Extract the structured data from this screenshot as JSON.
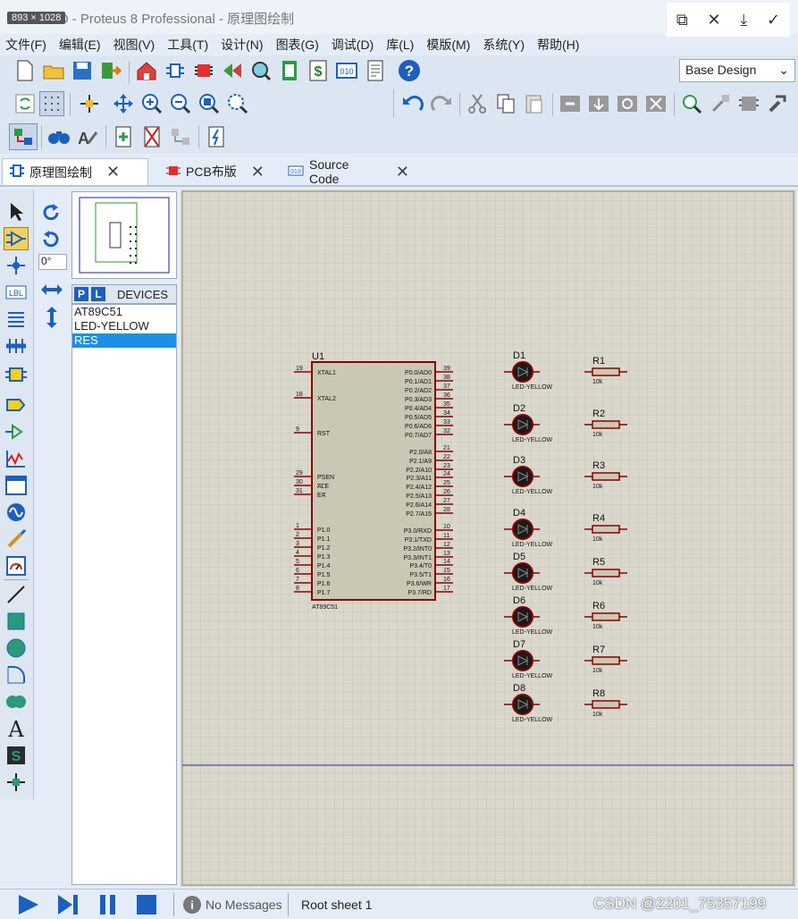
{
  "window": {
    "title": "1.51 LED - Proteus 8 Professional - 原理图绘制",
    "size_badge": "893 × 1028"
  },
  "menu": [
    "文件(F)",
    "编辑(E)",
    "视图(V)",
    "工具(T)",
    "设计(N)",
    "图表(G)",
    "调试(D)",
    "库(L)",
    "模版(M)",
    "系统(Y)",
    "帮助(H)"
  ],
  "design_select": "Base Design",
  "tabs": [
    {
      "label": "原理图绘制"
    },
    {
      "label": "PCB布版"
    },
    {
      "label": "Source Code"
    }
  ],
  "rotation": "0°",
  "devices": {
    "header": "DEVICES",
    "p": "P",
    "l": "L",
    "items": [
      "AT89C51",
      "LED-YELLOW",
      "RES"
    ],
    "selected": "RES"
  },
  "chip": {
    "ref": "U1",
    "name": "AT89C51",
    "left_pins": [
      {
        "n": "19",
        "l": "XTAL1"
      },
      {
        "n": "18",
        "l": "XTAL2"
      },
      {
        "n": "9",
        "l": "RST"
      },
      {
        "n": "29",
        "l": "PSEN"
      },
      {
        "n": "30",
        "l": "ALE"
      },
      {
        "n": "31",
        "l": "EA"
      },
      {
        "n": "1",
        "l": "P1.0"
      },
      {
        "n": "2",
        "l": "P1.1"
      },
      {
        "n": "3",
        "l": "P1.2"
      },
      {
        "n": "4",
        "l": "P1.3"
      },
      {
        "n": "5",
        "l": "P1.4"
      },
      {
        "n": "6",
        "l": "P1.5"
      },
      {
        "n": "7",
        "l": "P1.6"
      },
      {
        "n": "8",
        "l": "P1.7"
      }
    ],
    "right_pins": [
      {
        "n": "39",
        "l": "P0.0/AD0"
      },
      {
        "n": "38",
        "l": "P0.1/AD1"
      },
      {
        "n": "37",
        "l": "P0.2/AD2"
      },
      {
        "n": "36",
        "l": "P0.3/AD3"
      },
      {
        "n": "35",
        "l": "P0.4/AD4"
      },
      {
        "n": "34",
        "l": "P0.5/AD5"
      },
      {
        "n": "33",
        "l": "P0.6/AD6"
      },
      {
        "n": "32",
        "l": "P0.7/AD7"
      },
      {
        "n": "21",
        "l": "P2.0/A8"
      },
      {
        "n": "22",
        "l": "P2.1/A9"
      },
      {
        "n": "23",
        "l": "P2.2/A10"
      },
      {
        "n": "24",
        "l": "P2.3/A11"
      },
      {
        "n": "25",
        "l": "P2.4/A12"
      },
      {
        "n": "26",
        "l": "P2.5/A13"
      },
      {
        "n": "27",
        "l": "P2.6/A14"
      },
      {
        "n": "28",
        "l": "P2.7/A15"
      },
      {
        "n": "10",
        "l": "P3.0/RXD"
      },
      {
        "n": "11",
        "l": "P3.1/TXD"
      },
      {
        "n": "12",
        "l": "P3.2/INT0"
      },
      {
        "n": "13",
        "l": "P3.3/INT1"
      },
      {
        "n": "14",
        "l": "P3.4/T0"
      },
      {
        "n": "15",
        "l": "P3.5/T1"
      },
      {
        "n": "16",
        "l": "P3.6/WR"
      },
      {
        "n": "17",
        "l": "P3.7/RD"
      }
    ]
  },
  "leds": [
    {
      "ref": "D1",
      "type": "LED-YELLOW"
    },
    {
      "ref": "D2",
      "type": "LED-YELLOW"
    },
    {
      "ref": "D3",
      "type": "LED-YELLOW"
    },
    {
      "ref": "D4",
      "type": "LED-YELLOW"
    },
    {
      "ref": "D5",
      "type": "LED-YELLOW"
    },
    {
      "ref": "D6",
      "type": "LED-YELLOW"
    },
    {
      "ref": "D7",
      "type": "LED-YELLOW"
    },
    {
      "ref": "D8",
      "type": "LED-YELLOW"
    }
  ],
  "resistors": [
    {
      "ref": "R1",
      "value": "10k"
    },
    {
      "ref": "R2",
      "value": "10k"
    },
    {
      "ref": "R3",
      "value": "10k"
    },
    {
      "ref": "R4",
      "value": "10k"
    },
    {
      "ref": "R5",
      "value": "10k"
    },
    {
      "ref": "R6",
      "value": "10k"
    },
    {
      "ref": "R7",
      "value": "10k"
    },
    {
      "ref": "R8",
      "value": "10k"
    }
  ],
  "status": {
    "messages": "No Messages",
    "sheet": "Root sheet 1",
    "watermark": "CSDN @2201_75357199"
  },
  "colors": {
    "accent": "#1d5fbf",
    "grid_bg": "#dad8cc",
    "chip_fill": "#c8c8b4",
    "wire": "#8b0000",
    "selection": "#1e8fe8"
  }
}
